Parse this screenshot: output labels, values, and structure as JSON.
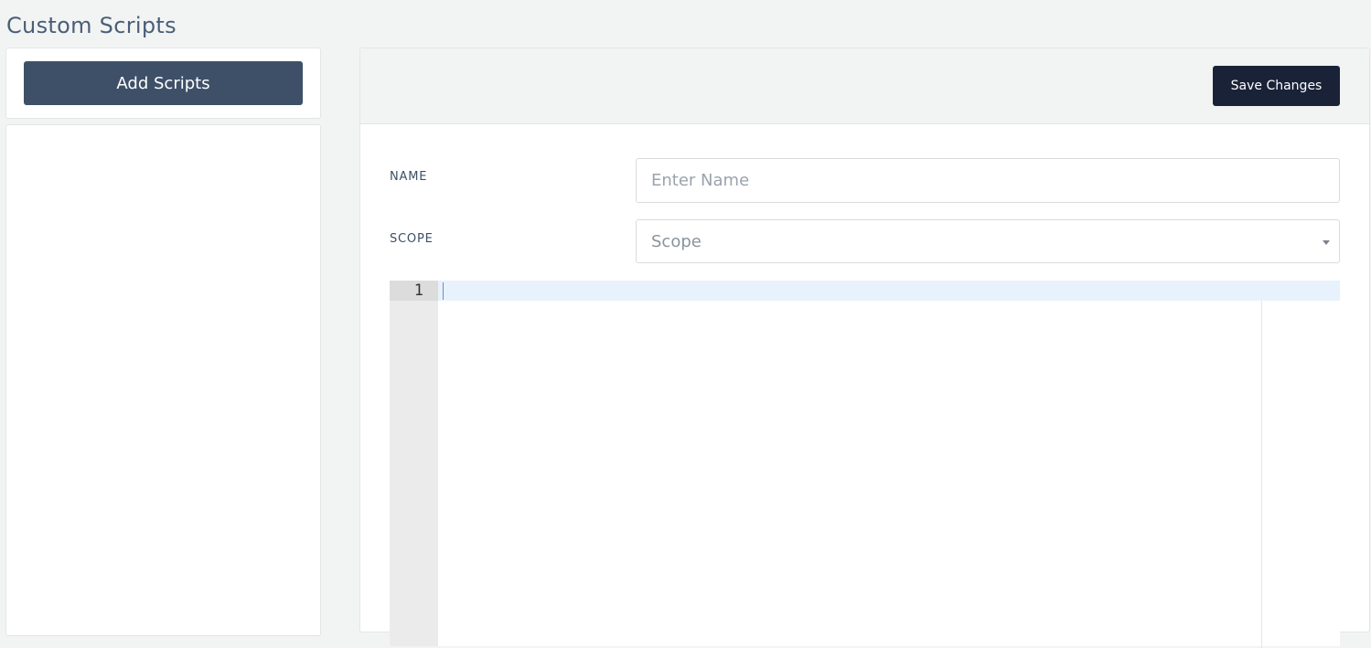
{
  "page": {
    "title": "Custom Scripts"
  },
  "sidebar": {
    "add_button_label": "Add Scripts"
  },
  "toolbar": {
    "save_label": "Save Changes"
  },
  "form": {
    "name_label": "NAME",
    "name_placeholder": "Enter Name",
    "name_value": "",
    "scope_label": "SCOPE",
    "scope_placeholder": "Scope"
  },
  "editor": {
    "line_numbers": [
      "1"
    ]
  },
  "colors": {
    "add_button_bg": "#3e5068",
    "save_button_bg": "#1a2238",
    "active_line_bg": "#e8f2fc"
  }
}
